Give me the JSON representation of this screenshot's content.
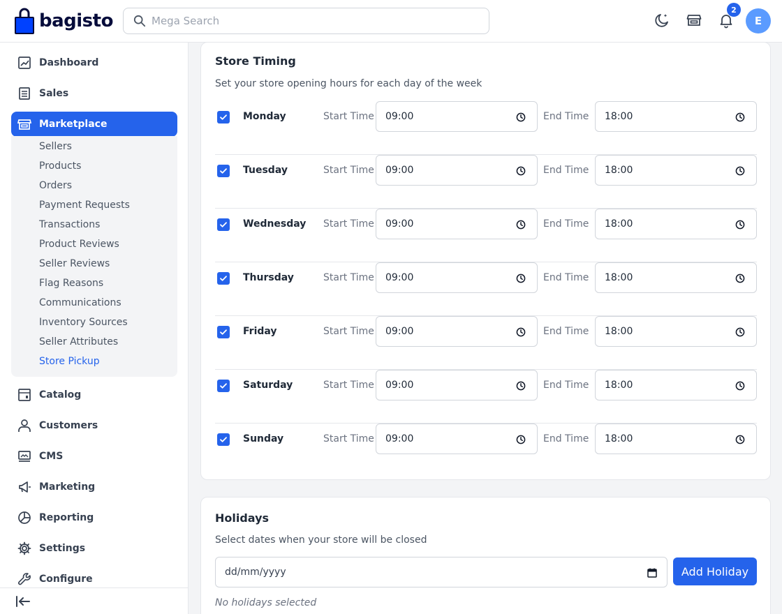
{
  "header": {
    "logo_text": "bagisto",
    "search_placeholder": "Mega Search",
    "notification_count": "2",
    "avatar_initial": "E"
  },
  "sidebar": {
    "items": [
      {
        "label": "Dashboard",
        "icon": "dashboard-icon"
      },
      {
        "label": "Sales",
        "icon": "sales-icon"
      },
      {
        "label": "Marketplace",
        "icon": "store-icon",
        "active": true
      },
      {
        "label": "Catalog",
        "icon": "catalog-icon"
      },
      {
        "label": "Customers",
        "icon": "customers-icon"
      },
      {
        "label": "CMS",
        "icon": "cms-icon"
      },
      {
        "label": "Marketing",
        "icon": "marketing-icon"
      },
      {
        "label": "Reporting",
        "icon": "reporting-icon"
      },
      {
        "label": "Settings",
        "icon": "settings-icon"
      },
      {
        "label": "Configure",
        "icon": "configure-icon"
      }
    ],
    "marketplace_submenu": [
      "Sellers",
      "Products",
      "Orders",
      "Payment Requests",
      "Transactions",
      "Product Reviews",
      "Seller Reviews",
      "Flag Reasons",
      "Communications",
      "Inventory Sources",
      "Seller Attributes",
      "Store Pickup"
    ],
    "current_submenu": "Store Pickup"
  },
  "store_timing": {
    "title": "Store Timing",
    "description": "Set your store opening hours for each day of the week",
    "start_label": "Start Time",
    "end_label": "End Time",
    "days": [
      {
        "day": "Monday",
        "checked": true,
        "start": "09:00",
        "end": "18:00"
      },
      {
        "day": "Tuesday",
        "checked": true,
        "start": "09:00",
        "end": "18:00"
      },
      {
        "day": "Wednesday",
        "checked": true,
        "start": "09:00",
        "end": "18:00"
      },
      {
        "day": "Thursday",
        "checked": true,
        "start": "09:00",
        "end": "18:00"
      },
      {
        "day": "Friday",
        "checked": true,
        "start": "09:00",
        "end": "18:00"
      },
      {
        "day": "Saturday",
        "checked": true,
        "start": "09:00",
        "end": "18:00"
      },
      {
        "day": "Sunday",
        "checked": true,
        "start": "09:00",
        "end": "18:00"
      }
    ]
  },
  "holidays": {
    "title": "Holidays",
    "description": "Select dates when your store will be closed",
    "date_placeholder": "dd/mm/yyyy",
    "add_button": "Add Holiday",
    "empty_text": "No holidays selected"
  },
  "colors": {
    "accent": "#2563eb",
    "brand_dark": "#060C3B"
  }
}
